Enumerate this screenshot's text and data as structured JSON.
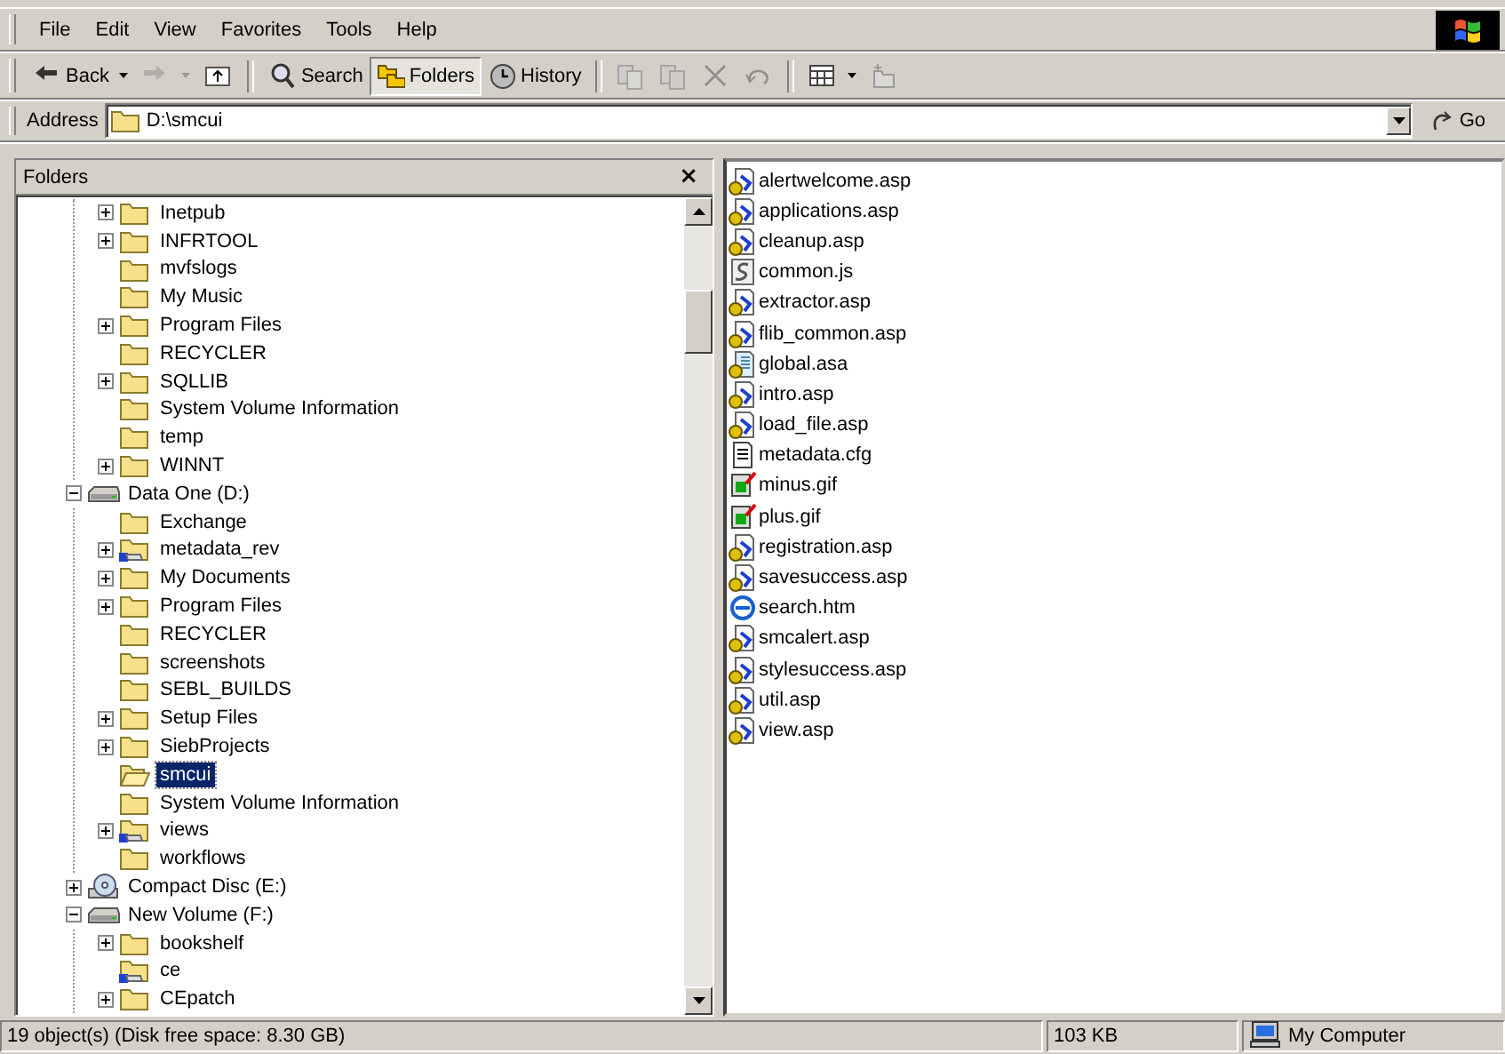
{
  "menu": [
    "File",
    "Edit",
    "View",
    "Favorites",
    "Tools",
    "Help"
  ],
  "toolbar": [
    {
      "kind": "back",
      "label": "Back",
      "dropdown": true,
      "disabled": false,
      "selected": false
    },
    {
      "kind": "forward",
      "dropdown": true,
      "disabled": true,
      "selected": false
    },
    {
      "kind": "up",
      "disabled": false,
      "selected": false
    },
    {
      "kind": "separator"
    },
    {
      "kind": "search",
      "label": "Search",
      "disabled": false,
      "selected": false
    },
    {
      "kind": "folders",
      "label": "Folders",
      "disabled": false,
      "selected": true
    },
    {
      "kind": "history",
      "label": "History",
      "disabled": false,
      "selected": false
    },
    {
      "kind": "separator"
    },
    {
      "kind": "move",
      "disabled": true,
      "selected": false
    },
    {
      "kind": "copy",
      "disabled": true,
      "selected": false
    },
    {
      "kind": "delete",
      "disabled": true,
      "selected": false
    },
    {
      "kind": "undo",
      "disabled": true,
      "selected": false
    },
    {
      "kind": "separator"
    },
    {
      "kind": "views",
      "dropdown": true,
      "disabled": false,
      "selected": false
    },
    {
      "kind": "newfolder",
      "disabled": true,
      "selected": false
    }
  ],
  "address": {
    "label": "Address",
    "value": "D:\\smcui",
    "go": "Go"
  },
  "folders_pane": {
    "title": "Folders",
    "close": "×",
    "continued_children": [
      {
        "label": "Inetpub",
        "kind": "folder",
        "expandable": true,
        "expanded": false,
        "selected": false
      },
      {
        "label": "INFRTOOL",
        "kind": "folder",
        "expandable": true,
        "expanded": false,
        "selected": false
      },
      {
        "label": "mvfslogs",
        "kind": "folder",
        "expandable": false,
        "selected": false
      },
      {
        "label": "My Music",
        "kind": "folder",
        "expandable": false,
        "selected": false
      },
      {
        "label": "Program Files",
        "kind": "folder",
        "expandable": true,
        "expanded": false,
        "selected": false
      },
      {
        "label": "RECYCLER",
        "kind": "folder",
        "expandable": false,
        "selected": false
      },
      {
        "label": "SQLLIB",
        "kind": "folder",
        "expandable": true,
        "expanded": false,
        "selected": false
      },
      {
        "label": "System Volume Information",
        "kind": "folder",
        "expandable": false,
        "selected": false
      },
      {
        "label": "temp",
        "kind": "folder",
        "expandable": false,
        "selected": false
      },
      {
        "label": "WINNT",
        "kind": "folder",
        "expandable": true,
        "expanded": false,
        "selected": false
      }
    ],
    "items": [
      {
        "label": "Data One (D:)",
        "kind": "drive",
        "expandable": true,
        "expanded": true,
        "selected": false,
        "children": [
          {
            "label": "Exchange",
            "kind": "folder",
            "expandable": false,
            "selected": false
          },
          {
            "label": "metadata_rev",
            "kind": "shared_folder",
            "expandable": true,
            "expanded": false,
            "selected": false
          },
          {
            "label": "My Documents",
            "kind": "folder",
            "expandable": true,
            "expanded": false,
            "selected": false
          },
          {
            "label": "Program Files",
            "kind": "folder",
            "expandable": true,
            "expanded": false,
            "selected": false
          },
          {
            "label": "RECYCLER",
            "kind": "folder",
            "expandable": false,
            "selected": false
          },
          {
            "label": "screenshots",
            "kind": "folder",
            "expandable": false,
            "selected": false
          },
          {
            "label": "SEBL_BUILDS",
            "kind": "folder",
            "expandable": false,
            "selected": false
          },
          {
            "label": "Setup Files",
            "kind": "folder",
            "expandable": true,
            "expanded": false,
            "selected": false
          },
          {
            "label": "SiebProjects",
            "kind": "folder",
            "expandable": true,
            "expanded": false,
            "selected": false
          },
          {
            "label": "smcui",
            "kind": "open_folder",
            "expandable": false,
            "selected": true
          },
          {
            "label": "System Volume Information",
            "kind": "folder",
            "expandable": false,
            "selected": false
          },
          {
            "label": "views",
            "kind": "shared_folder",
            "expandable": true,
            "expanded": false,
            "selected": false
          },
          {
            "label": "workflows",
            "kind": "folder",
            "expandable": false,
            "selected": false
          }
        ]
      },
      {
        "label": "Compact Disc (E:)",
        "kind": "cd",
        "expandable": true,
        "expanded": false,
        "selected": false
      },
      {
        "label": "New Volume (F:)",
        "kind": "drive",
        "expandable": true,
        "expanded": true,
        "selected": false,
        "children": [
          {
            "label": "bookshelf",
            "kind": "folder",
            "expandable": true,
            "expanded": false,
            "selected": false
          },
          {
            "label": "ce",
            "kind": "shared_folder",
            "expandable": false,
            "selected": false
          },
          {
            "label": "CEpatch",
            "kind": "folder",
            "expandable": true,
            "expanded": false,
            "selected": false
          }
        ]
      }
    ]
  },
  "files": [
    {
      "name": "alertwelcome.asp",
      "kind": "script"
    },
    {
      "name": "applications.asp",
      "kind": "script"
    },
    {
      "name": "cleanup.asp",
      "kind": "script"
    },
    {
      "name": "common.js",
      "kind": "js"
    },
    {
      "name": "extractor.asp",
      "kind": "script"
    },
    {
      "name": "flib_common.asp",
      "kind": "script"
    },
    {
      "name": "global.asa",
      "kind": "asa"
    },
    {
      "name": "intro.asp",
      "kind": "script"
    },
    {
      "name": "load_file.asp",
      "kind": "script"
    },
    {
      "name": "metadata.cfg",
      "kind": "text"
    },
    {
      "name": "minus.gif",
      "kind": "image"
    },
    {
      "name": "plus.gif",
      "kind": "image"
    },
    {
      "name": "registration.asp",
      "kind": "script"
    },
    {
      "name": "savesuccess.asp",
      "kind": "script"
    },
    {
      "name": "search.htm",
      "kind": "web"
    },
    {
      "name": "smcalert.asp",
      "kind": "script"
    },
    {
      "name": "stylesuccess.asp",
      "kind": "script"
    },
    {
      "name": "util.asp",
      "kind": "script"
    },
    {
      "name": "view.asp",
      "kind": "script"
    }
  ],
  "status_bar": {
    "objects": "19 object(s) (Disk free space: 8.30 GB)",
    "size": "103 KB",
    "zone": "My Computer"
  }
}
